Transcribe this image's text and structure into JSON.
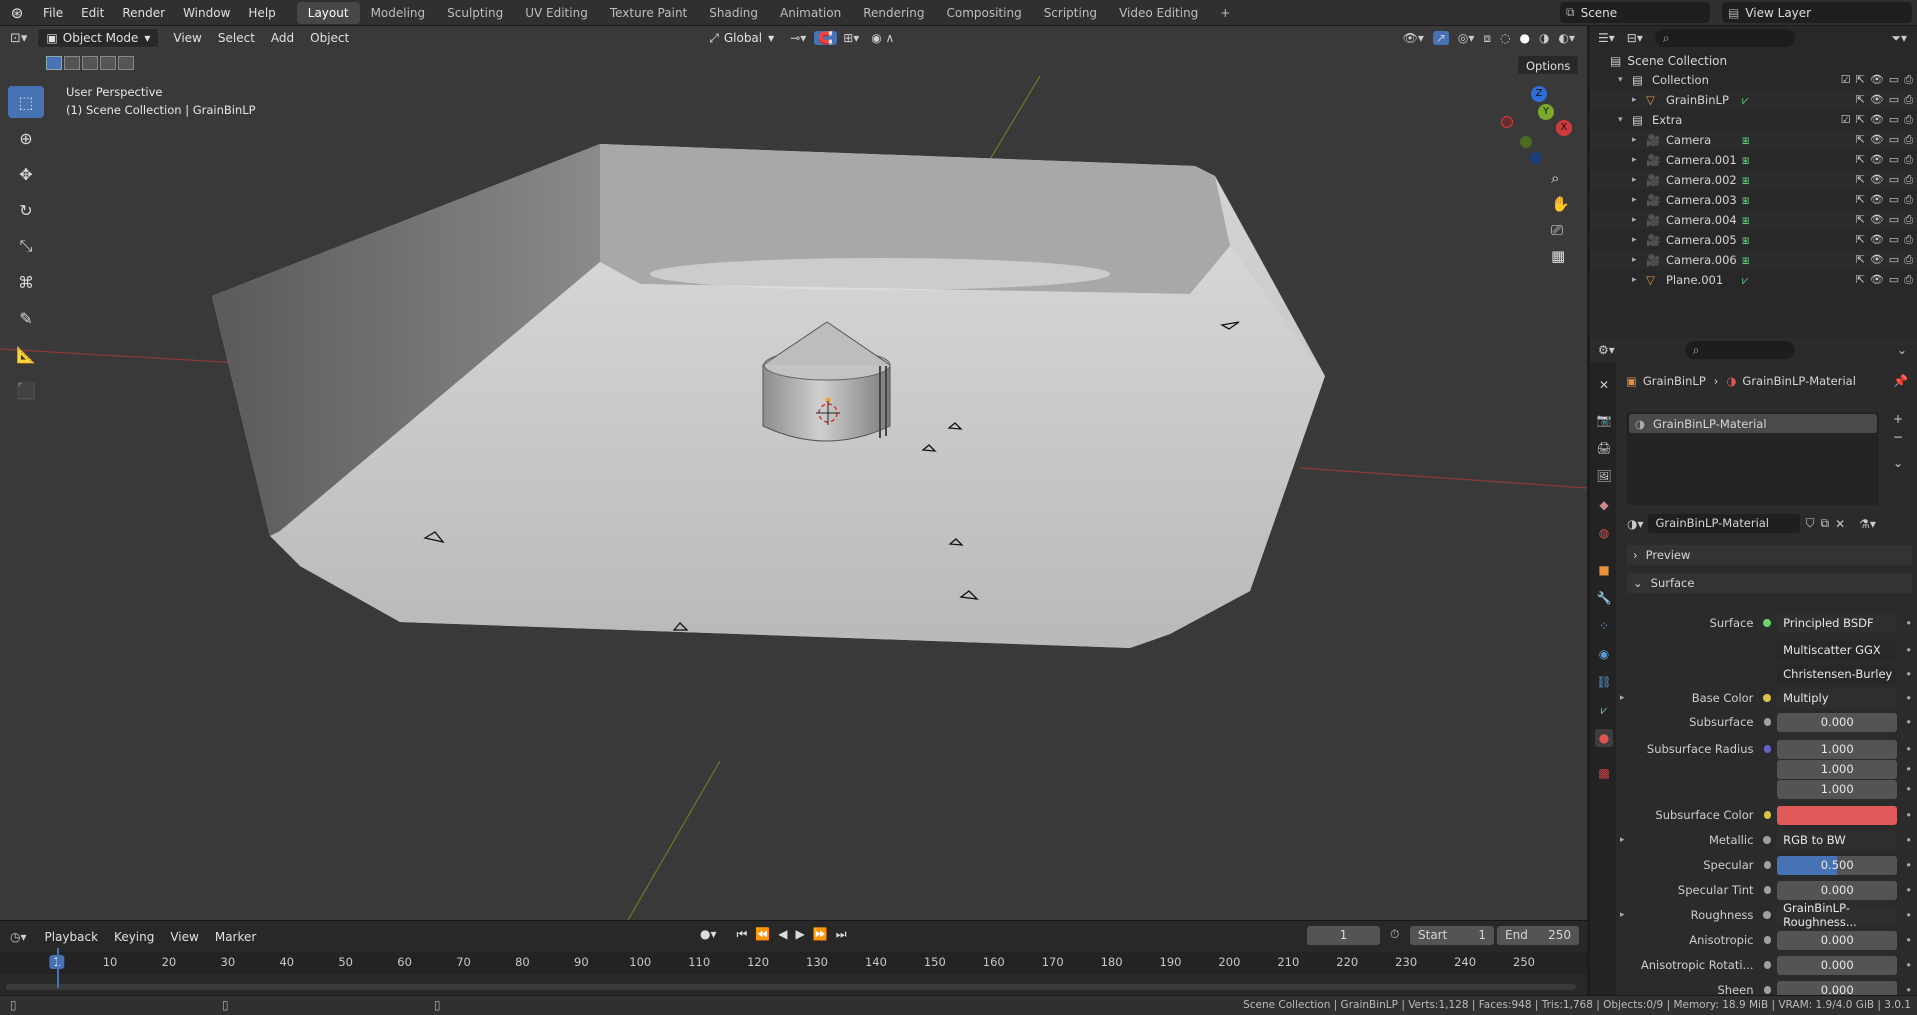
{
  "menu": {
    "items": [
      "File",
      "Edit",
      "Render",
      "Window",
      "Help"
    ]
  },
  "workspaces": {
    "tabs": [
      "Layout",
      "Modeling",
      "Sculpting",
      "UV Editing",
      "Texture Paint",
      "Shading",
      "Animation",
      "Rendering",
      "Compositing",
      "Scripting",
      "Video Editing"
    ],
    "add": "+"
  },
  "scene": {
    "name": "Scene",
    "view_layer": "View Layer"
  },
  "viewport": {
    "mode": "Object Mode",
    "menus": [
      "View",
      "Select",
      "Add",
      "Object"
    ],
    "transform": "Global",
    "options": "Options",
    "perspective": "User Perspective",
    "collection_info": "(1) Scene Collection | GrainBinLP",
    "gizmo_x": "X",
    "gizmo_y": "Y",
    "gizmo_z": "Z"
  },
  "outliner": {
    "root": "Scene Collection",
    "rows": [
      {
        "label": "Collection",
        "indent": 1,
        "type": "collection"
      },
      {
        "label": "GrainBinLP",
        "indent": 2,
        "type": "mesh"
      },
      {
        "label": "Extra",
        "indent": 1,
        "type": "collection"
      },
      {
        "label": "Camera",
        "indent": 2,
        "type": "camera"
      },
      {
        "label": "Camera.001",
        "indent": 2,
        "type": "camera"
      },
      {
        "label": "Camera.002",
        "indent": 2,
        "type": "camera"
      },
      {
        "label": "Camera.003",
        "indent": 2,
        "type": "camera"
      },
      {
        "label": "Camera.004",
        "indent": 2,
        "type": "camera"
      },
      {
        "label": "Camera.005",
        "indent": 2,
        "type": "camera"
      },
      {
        "label": "Camera.006",
        "indent": 2,
        "type": "camera"
      },
      {
        "label": "Plane.001",
        "indent": 2,
        "type": "mesh"
      }
    ]
  },
  "properties": {
    "breadcrumb_object": "GrainBinLP",
    "breadcrumb_material": "GrainBinLP-Material",
    "slot": "GrainBinLP-Material",
    "material_name": "GrainBinLP-Material",
    "panel_preview": "Preview",
    "panel_surface": "Surface",
    "rows": [
      {
        "label": "Surface",
        "value": "Principled BSDF",
        "kind": "link",
        "dot": "#6bd36b"
      },
      {
        "label": "",
        "value": "Multiscatter GGX",
        "kind": "dropdown"
      },
      {
        "label": "",
        "value": "Christensen-Burley",
        "kind": "dropdown"
      },
      {
        "label": "Base Color",
        "value": "Multiply",
        "kind": "link",
        "dot": "#d9c44a",
        "expand": true
      },
      {
        "label": "Subsurface",
        "value": "0.000",
        "kind": "number",
        "dot": "#a0a0a0"
      },
      {
        "label": "Subsurface Radius",
        "value": "1.000",
        "kind": "number",
        "dot": "#6363c7"
      },
      {
        "label": "",
        "value": "1.000",
        "kind": "number"
      },
      {
        "label": "",
        "value": "1.000",
        "kind": "number"
      },
      {
        "label": "Subsurface Color",
        "value": "",
        "kind": "color",
        "dot": "#d9c44a",
        "color": "#e05a5a"
      },
      {
        "label": "Metallic",
        "value": "RGB to BW",
        "kind": "link",
        "dot": "#a0a0a0",
        "expand": true
      },
      {
        "label": "Specular",
        "value": "0.500",
        "kind": "slider",
        "dot": "#a0a0a0",
        "fill": 0.5
      },
      {
        "label": "Specular Tint",
        "value": "0.000",
        "kind": "number",
        "dot": "#a0a0a0"
      },
      {
        "label": "Roughness",
        "value": "GrainBinLP-Roughness...",
        "kind": "link",
        "dot": "#a0a0a0",
        "expand": true
      },
      {
        "label": "Anisotropic",
        "value": "0.000",
        "kind": "number",
        "dot": "#a0a0a0"
      },
      {
        "label": "Anisotropic Rotati...",
        "value": "0.000",
        "kind": "number",
        "dot": "#a0a0a0"
      },
      {
        "label": "Sheen",
        "value": "0.000",
        "kind": "number",
        "dot": "#a0a0a0"
      }
    ]
  },
  "timeline": {
    "menus": [
      "Playback",
      "Keying",
      "View",
      "Marker"
    ],
    "current_frame": "1",
    "start_label": "Start",
    "start": "1",
    "end_label": "End",
    "end": "250",
    "ticks": [
      "1",
      "10",
      "20",
      "30",
      "40",
      "50",
      "60",
      "70",
      "80",
      "90",
      "100",
      "110",
      "120",
      "130",
      "140",
      "150",
      "160",
      "170",
      "180",
      "190",
      "200",
      "210",
      "220",
      "230",
      "240",
      "250"
    ]
  },
  "status": {
    "text": "Scene Collection | GrainBinLP | Verts:1,128 | Faces:948 | Tris:1,768 | Objects:0/9 | Memory: 18.9 MiB | VRAM: 1.9/4.0 GiB | 3.0.1"
  }
}
